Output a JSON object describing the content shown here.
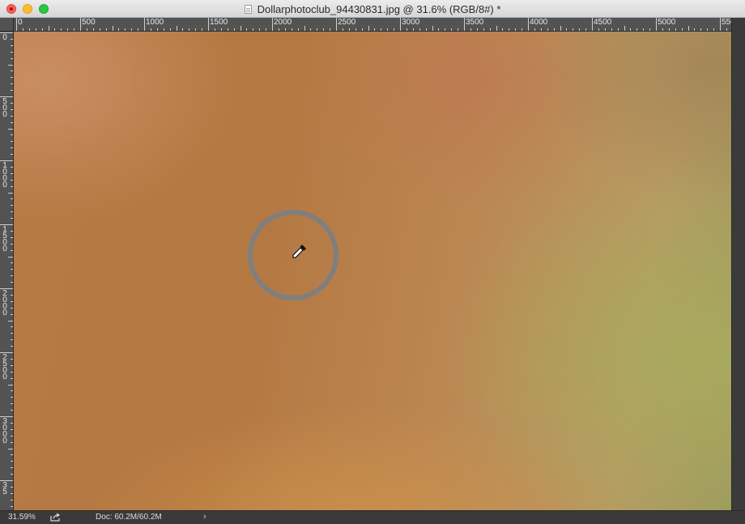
{
  "window": {
    "title": "Dollarphotoclub_94430831.jpg @ 31.6% (RGB/8#) *"
  },
  "ruler": {
    "top_labels": [
      "0",
      "500",
      "1000",
      "1500",
      "2000",
      "2500",
      "3000",
      "3500",
      "4000",
      "4500",
      "5000",
      "550"
    ],
    "left_labels": [
      "0",
      "500",
      "1000",
      "1500",
      "2000",
      "2500",
      "3000",
      "35"
    ]
  },
  "tool": {
    "name": "eyedropper-icon",
    "sample_ring": "brush-ring"
  },
  "status": {
    "zoom": "31.59%",
    "doc": "Doc: 60.2M/60.2M",
    "arrow": "›"
  },
  "colors": {
    "canvas_orange": "#b67a44",
    "canvas_green": "#a8aa5f",
    "ui_dark": "#535353"
  }
}
